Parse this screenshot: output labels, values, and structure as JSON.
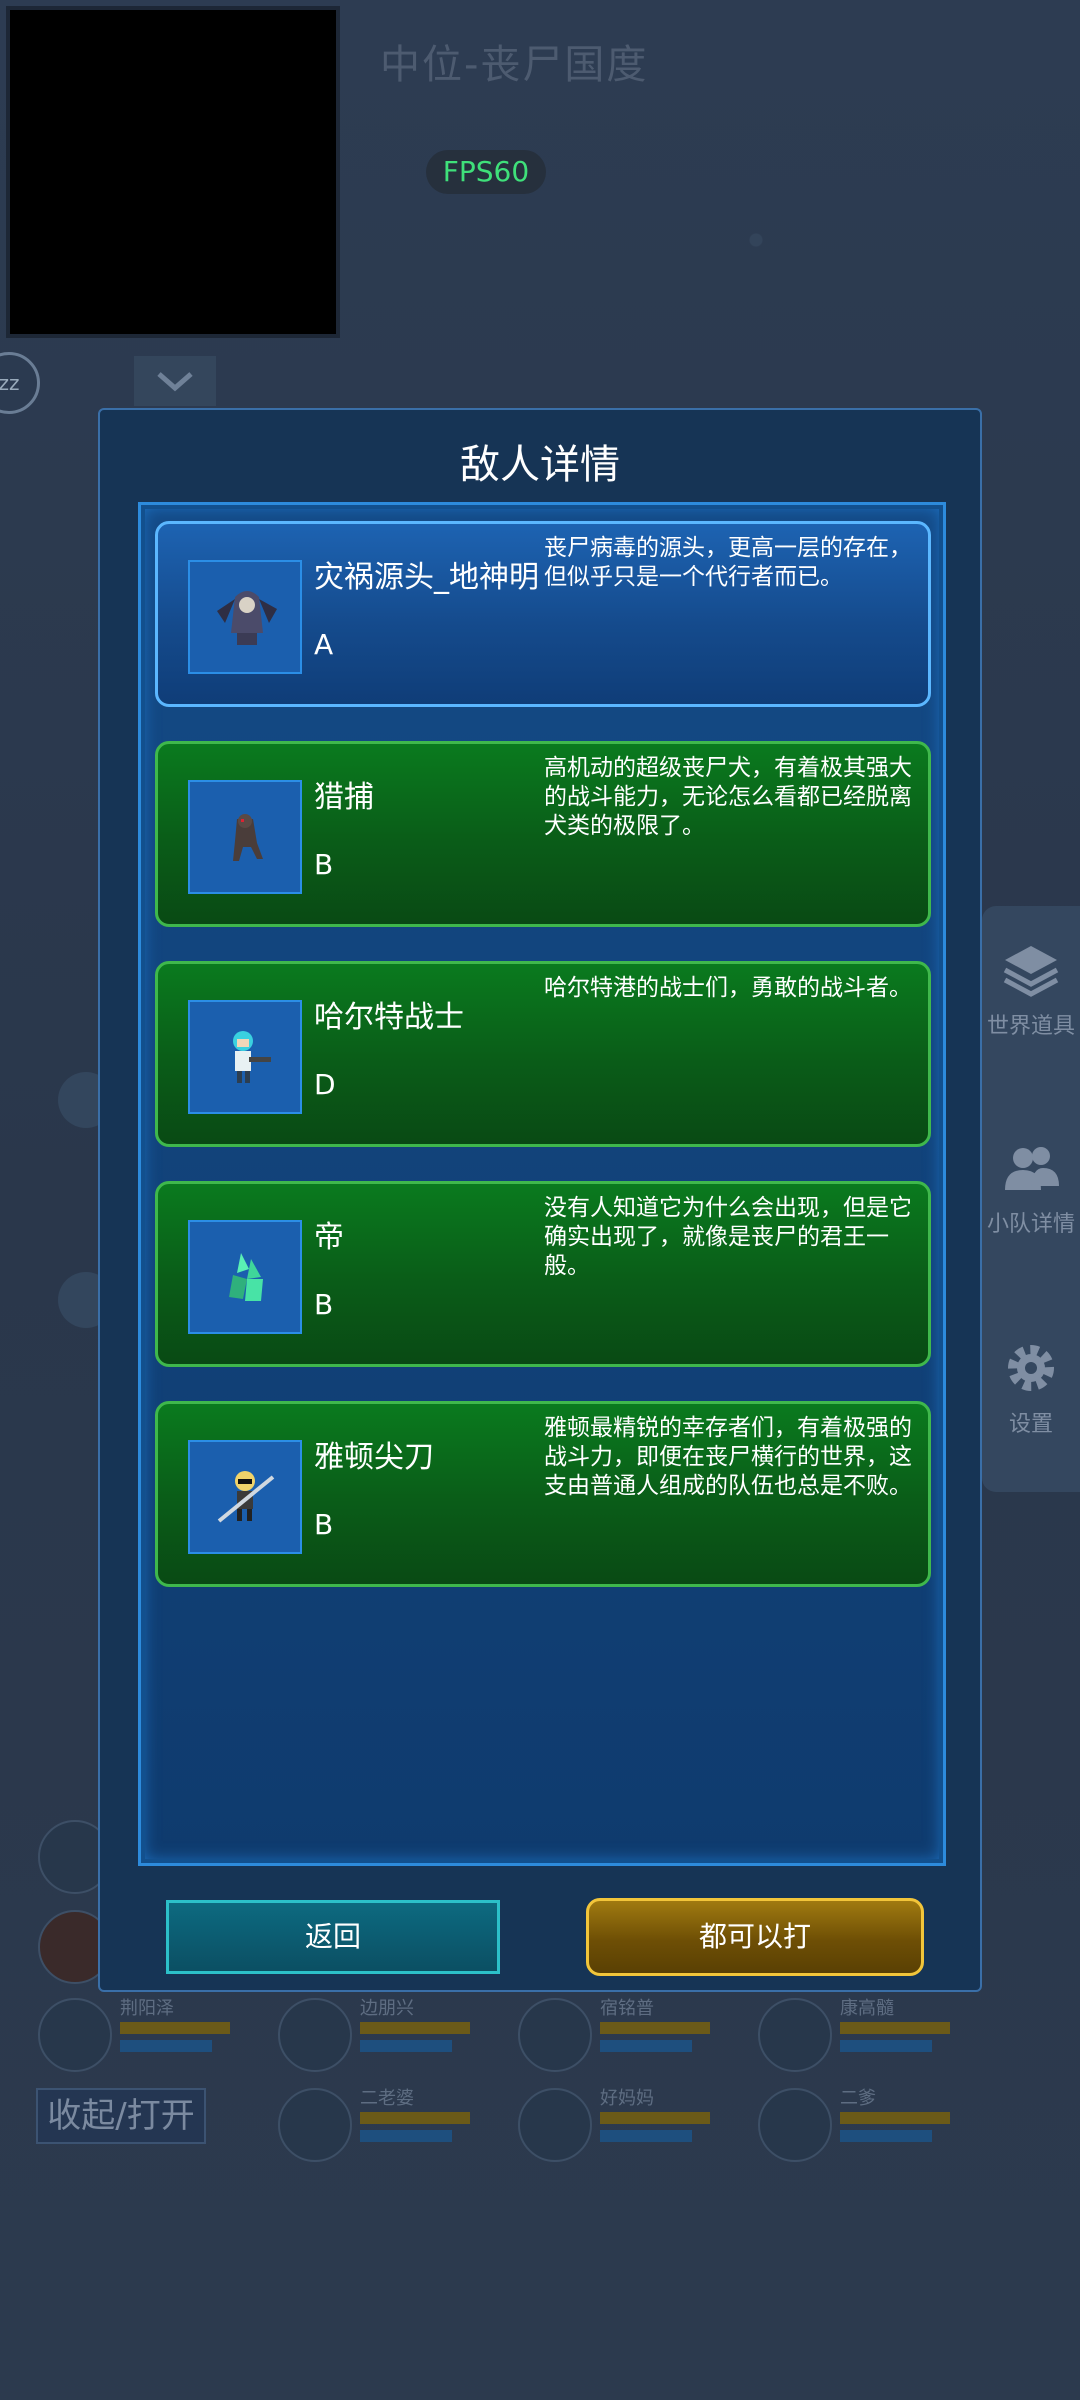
{
  "stage_title": "中位-丧尸国度",
  "fps": "FPS60",
  "zz_label": "zz",
  "side_menu": [
    {
      "label": "世界道具",
      "icon": "layers-icon"
    },
    {
      "label": "小队详情",
      "icon": "team-icon"
    },
    {
      "label": "设置",
      "icon": "gear-icon"
    }
  ],
  "team": [
    {
      "name": "荆阳泽"
    },
    {
      "name": "边朋兴"
    },
    {
      "name": "宿铭普"
    },
    {
      "name": "康高髓"
    },
    {
      "name": "二老婆"
    },
    {
      "name": "好妈妈"
    },
    {
      "name": "二爹"
    }
  ],
  "toggle_label": "收起/打开",
  "dialog": {
    "title": "敌人详情",
    "enemies": [
      {
        "name": "灾祸源头_地神明",
        "rank": "A",
        "desc": "丧尸病毒的源头，更高一层的存在，但似乎只是一个代行者而已。",
        "style": "blue"
      },
      {
        "name": "猎捕",
        "rank": "B",
        "desc": "高机动的超级丧尸犬，有着极其强大的战斗能力，无论怎么看都已经脱离犬类的极限了。",
        "style": "green"
      },
      {
        "name": "哈尔特战士",
        "rank": "D",
        "desc": "哈尔特港的战士们，勇敢的战斗者。",
        "style": "green"
      },
      {
        "name": "帝",
        "rank": "B",
        "desc": "没有人知道它为什么会出现，但是它确实出现了，就像是丧尸的君王一般。",
        "style": "green"
      },
      {
        "name": "雅顿尖刀",
        "rank": "B",
        "desc": "雅顿最精锐的幸存者们，有着极强的战斗力，即便在丧尸横行的世界，这支由普通人组成的队伍也总是不败。",
        "style": "green"
      }
    ],
    "back_label": "返回",
    "fight_label": "都可以打"
  }
}
